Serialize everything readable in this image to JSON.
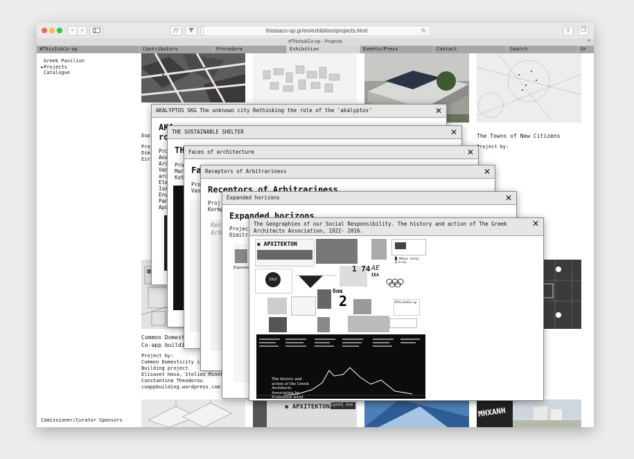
{
  "browser": {
    "url": "thisisaco-op.gr/en/exhibition/projects.html",
    "tab_title": "#ThisIsACo-op - Projects",
    "reader_icon": "f?",
    "back_icon": "chevron-left-icon",
    "forward_icon": "chevron-right-icon"
  },
  "site_nav": {
    "brand": "#ThisIsACo-op",
    "items": [
      "Contributors",
      "Procedure",
      "Exhibition",
      "Events/Press",
      "Contact",
      "Search",
      "Gr"
    ],
    "active": "Exhibition"
  },
  "sidebar": {
    "items": [
      "Greek Pavilion",
      "►Projects",
      "Catalogue"
    ],
    "footer": [
      "Comissioner/Curator",
      "Sponsors"
    ]
  },
  "projects": {
    "towns_title": "The Towns of New Citizens",
    "towns_by": "Project by:",
    "col1_fragments": [
      "Exp",
      "Proj",
      "Dimi",
      "Eiri"
    ],
    "common_title_1": "Common Domesticity",
    "common_title_2": "Co-app building",
    "common_by": "Project by:",
    "common_lines": [
      "Common Domesticity in Athens /",
      "Building project",
      "Elisavet Hasa, Stelios Minotakis,",
      "Constantina Theodorou",
      "coappbuilding.wordpress.com"
    ]
  },
  "modals": {
    "m1": {
      "header": "AKALYPTOS SKG The unknown city Rethinking the role of the 'akalyptos'",
      "title_frag": "AKA",
      "title_frag2": "ro",
      "lines": [
        "Proj",
        "Ana",
        "Arc",
        "Ven",
        "arc",
        "Ele",
        "Ioa",
        "Env",
        "Pan",
        "Apo"
      ]
    },
    "m2": {
      "header": "THE SUSTAINABLE SHELTER",
      "title_frag": "TH",
      "lines": [
        "Pro",
        "Mar",
        "Kot"
      ]
    },
    "m3": {
      "header": "Faces of architecture",
      "title_frag": "Fa",
      "lines": [
        "Pro",
        "Vas"
      ]
    },
    "m4": {
      "header": "Receptors of Arbitrariness",
      "title": "Receptors of Arbitrariness",
      "lines": [
        "Proj",
        "Kormp"
      ],
      "poster_text": "Rece\nArbit"
    },
    "m5": {
      "header": "Expanded horizons",
      "title": "Expanded horizons",
      "lines": [
        "Project",
        "Dimitri"
      ],
      "poster_text": "Expanded"
    },
    "m6": {
      "header_1": "The Geographies of our Social Responsibility. The history and action of The Greek",
      "header_2": "Architects Association, 1922- 2016.",
      "collage": {
        "masthead": "◉ ΑΡΧΙΤΕΚΤΟΝ",
        "year_badge": "1922",
        "num_74": "1 74",
        "num_2": "2",
        "sea_logo": "ΣΕΑ",
        "sa_logo": "δσα",
        "ae_logo": "AE",
        "athens_caption": "█ Αθήνα πολης φιλική",
        "hashtag": "#ThisIsACo-op",
        "chart_caption": "The history and action of the Greek Architects Association by Evaluation mind study."
      }
    }
  },
  "bottom_strip": {
    "architekton": "◉ ΑΡΧΙΤΕΚΤΟΝ",
    "schole": "Σχολή ουκ",
    "mixanh": "ΜΗΧΑΝΗ"
  },
  "colors": {
    "nav_bg": "#a6a6a6",
    "nav_active": "#d6d6d6",
    "modal_header": "#e6e6e6",
    "traffic_red": "#fb5f57",
    "traffic_yellow": "#fcbd2e",
    "traffic_green": "#29c940"
  }
}
